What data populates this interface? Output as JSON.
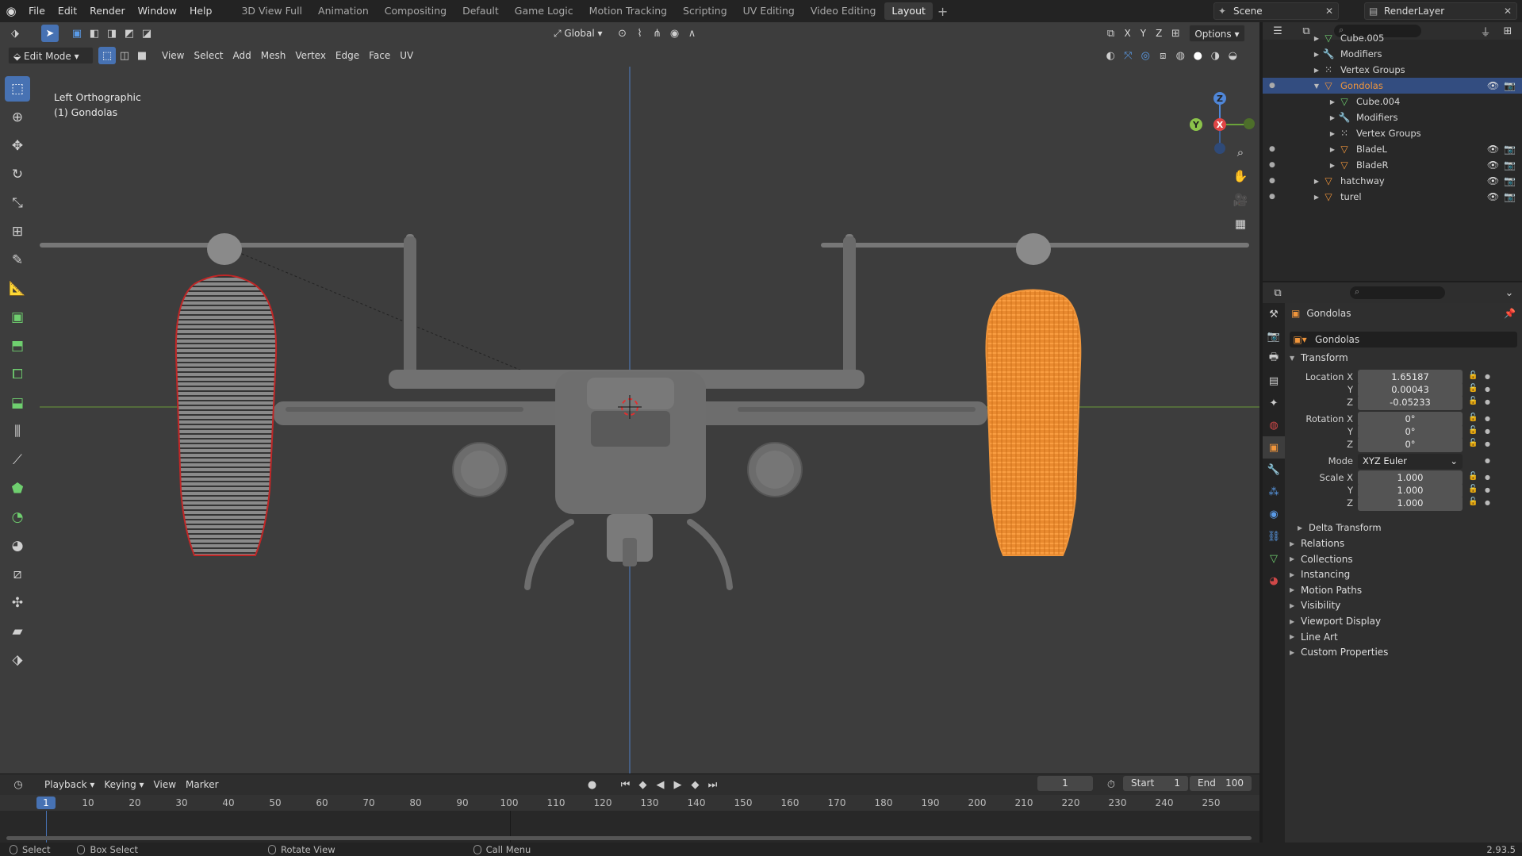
{
  "menubar": {
    "logo": "◉",
    "menus": [
      "File",
      "Edit",
      "Render",
      "Window",
      "Help"
    ],
    "workspaces": [
      "3D View Full",
      "Animation",
      "Compositing",
      "Default",
      "Game Logic",
      "Motion Tracking",
      "Scripting",
      "UV Editing",
      "Video Editing",
      "Layout"
    ],
    "active_workspace": "Layout",
    "scene": "Scene",
    "view_layer": "RenderLayer"
  },
  "viewport": {
    "mode": "Edit Mode",
    "menus": [
      "View",
      "Select",
      "Add",
      "Mesh",
      "Vertex",
      "Edge",
      "Face",
      "UV"
    ],
    "transform_orientation": "Global",
    "axes": [
      "X",
      "Y",
      "Z"
    ],
    "options_label": "Options",
    "view_name": "Left Orthographic",
    "object_label": "(1) Gondolas",
    "gizmo": {
      "z": "Z",
      "x": "X",
      "y": "Y"
    },
    "colors": {
      "background": "#3d3d3d",
      "selected": "#f0953b",
      "model": "#6f6f6f"
    }
  },
  "timeline": {
    "menus": [
      "Playback",
      "Keying",
      "View",
      "Marker"
    ],
    "current_frame": "1",
    "start_label": "Start",
    "start": "1",
    "end_label": "End",
    "end": "100",
    "ticks": [
      "10",
      "20",
      "30",
      "40",
      "50",
      "60",
      "70",
      "80",
      "90",
      "100",
      "110",
      "120",
      "130",
      "140",
      "150",
      "160",
      "170",
      "180",
      "190",
      "200",
      "210",
      "220",
      "230",
      "240",
      "250"
    ]
  },
  "statusbar": {
    "items": [
      "Select",
      "Box Select",
      "Rotate View",
      "Call Menu"
    ],
    "version": "2.93.5"
  },
  "outliner": {
    "rows": [
      {
        "label": "Cube.005",
        "icon": "mesh-data-icon",
        "level": 2,
        "selected": false,
        "visible": false
      },
      {
        "label": "Modifiers",
        "icon": "wrench-icon",
        "level": 2,
        "selected": false,
        "visible": false
      },
      {
        "label": "Vertex Groups",
        "icon": "vertex-groups-icon",
        "level": 2,
        "selected": false,
        "visible": false
      },
      {
        "label": "Gondolas",
        "icon": "object-icon",
        "level": 2,
        "selected": true,
        "visible": true
      },
      {
        "label": "Cube.004",
        "icon": "mesh-data-icon",
        "level": 3,
        "selected": false,
        "visible": false
      },
      {
        "label": "Modifiers",
        "icon": "wrench-icon",
        "level": 3,
        "selected": false,
        "visible": false
      },
      {
        "label": "Vertex Groups",
        "icon": "vertex-groups-icon",
        "level": 3,
        "selected": false,
        "visible": false
      },
      {
        "label": "BladeL",
        "icon": "object-icon",
        "level": 3,
        "selected": false,
        "visible": true
      },
      {
        "label": "BladeR",
        "icon": "object-icon",
        "level": 3,
        "selected": false,
        "visible": true
      },
      {
        "label": "hatchway",
        "icon": "object-icon",
        "level": 2,
        "selected": false,
        "visible": true
      },
      {
        "label": "turel",
        "icon": "object-icon",
        "level": 2,
        "selected": false,
        "visible": true
      }
    ]
  },
  "properties": {
    "object_name": "Gondolas",
    "data_name": "Gondolas",
    "transform_title": "Transform",
    "location_label": "Location X",
    "location": [
      "1.65187",
      "0.00043",
      "-0.05233"
    ],
    "rotation_label": "Rotation X",
    "rotation": [
      "0°",
      "0°",
      "0°"
    ],
    "mode_label": "Mode",
    "mode": "XYZ Euler",
    "scale_label": "Scale X",
    "scale": [
      "1.000",
      "1.000",
      "1.000"
    ],
    "axis_y": "Y",
    "axis_z": "Z",
    "delta": "Delta Transform",
    "sections": [
      "Relations",
      "Collections",
      "Instancing",
      "Motion Paths",
      "Visibility",
      "Viewport Display",
      "Line Art",
      "Custom Properties"
    ]
  }
}
